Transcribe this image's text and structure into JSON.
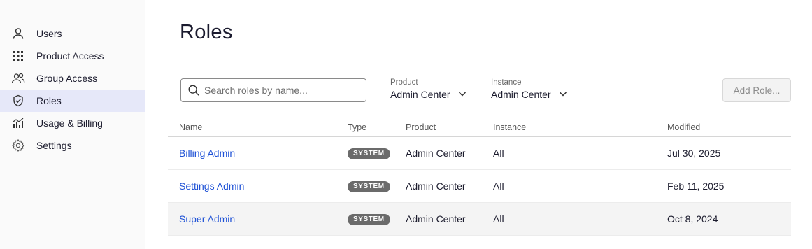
{
  "sidebar": {
    "items": [
      {
        "label": "Users",
        "icon": "user-icon"
      },
      {
        "label": "Product Access",
        "icon": "grid-icon"
      },
      {
        "label": "Group Access",
        "icon": "group-icon"
      },
      {
        "label": "Roles",
        "icon": "shield-icon",
        "active": true
      },
      {
        "label": "Usage & Billing",
        "icon": "chart-icon"
      },
      {
        "label": "Settings",
        "icon": "gear-icon"
      }
    ]
  },
  "page": {
    "title": "Roles"
  },
  "search": {
    "placeholder": "Search roles by name..."
  },
  "filters": {
    "product": {
      "label": "Product",
      "value": "Admin Center"
    },
    "instance": {
      "label": "Instance",
      "value": "Admin Center"
    }
  },
  "toolbar": {
    "add_role_label": "Add Role..."
  },
  "table": {
    "headers": {
      "name": "Name",
      "type": "Type",
      "product": "Product",
      "instance": "Instance",
      "modified": "Modified"
    },
    "rows": [
      {
        "name": "Billing Admin",
        "type": "SYSTEM",
        "product": "Admin Center",
        "instance": "All",
        "modified": "Jul 30, 2025"
      },
      {
        "name": "Settings Admin",
        "type": "SYSTEM",
        "product": "Admin Center",
        "instance": "All",
        "modified": "Feb 11, 2025"
      },
      {
        "name": "Super Admin",
        "type": "SYSTEM",
        "product": "Admin Center",
        "instance": "All",
        "modified": "Oct 8, 2024"
      }
    ]
  },
  "colors": {
    "accent": "#1f52d6",
    "active_nav": "#e6e8f9",
    "badge": "#6b6b6b"
  }
}
